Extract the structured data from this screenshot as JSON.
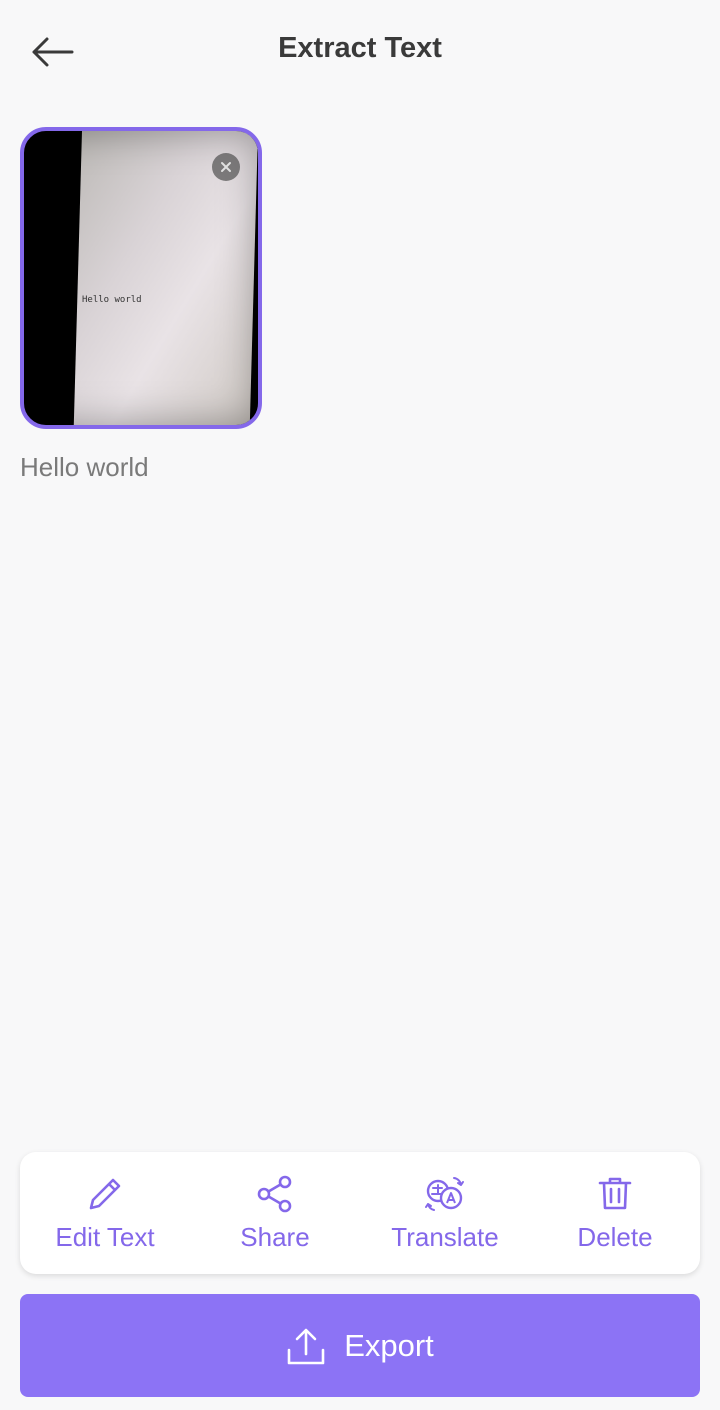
{
  "header": {
    "title": "Extract Text",
    "back_icon": "arrow-left-icon"
  },
  "image": {
    "photo_text": "Hello world",
    "close_icon": "close-icon"
  },
  "result": {
    "text": "Hello world"
  },
  "toolbar": {
    "items": [
      {
        "label": "Edit Text",
        "icon": "pencil-icon"
      },
      {
        "label": "Share",
        "icon": "share-icon"
      },
      {
        "label": "Translate",
        "icon": "translate-icon"
      },
      {
        "label": "Delete",
        "icon": "trash-icon"
      }
    ]
  },
  "export": {
    "label": "Export",
    "icon": "upload-icon"
  },
  "colors": {
    "accent": "#8468ea",
    "export_bg": "#8c73f5",
    "background": "#f8f8f9",
    "title": "#3a3a3a"
  }
}
